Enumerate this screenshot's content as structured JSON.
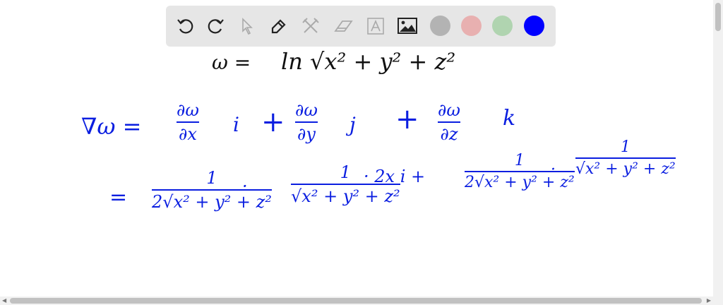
{
  "toolbar": {
    "tools": [
      "undo-icon",
      "redo-icon",
      "select-icon",
      "pen-icon",
      "tools-icon",
      "eraser-icon",
      "text-icon",
      "image-icon"
    ],
    "colors": [
      "#b3b3b3",
      "#e8b0b0",
      "#b0d4b0",
      "#0000ff"
    ]
  },
  "board": {
    "line1": {
      "lhs": "ω =",
      "rhs": "ln √x² + y² + z²"
    },
    "line2": {
      "lhs": "∇ω =",
      "t1_num": "∂ω",
      "t1_den": "∂x",
      "t1_unit": "i",
      "plus1": "+",
      "t2_num": "∂ω",
      "t2_den": "∂y",
      "t2_unit": "j",
      "plus2": "+",
      "t3_num": "∂ω",
      "t3_den": "∂z",
      "t3_unit": "k"
    },
    "line3": {
      "eq": "=",
      "f1_num": "1",
      "f1_den": "2√x² + y² + z²",
      "dot1": "·",
      "f2_num": "1",
      "f2_den": "√x² + y² + z²",
      "dot2": "· 2x  i  +",
      "f3_num": "1",
      "f3_den": "2√x² + y² + z²",
      "dot3": "·",
      "f4_num": "1",
      "f4_den": "√x² + y² + z²"
    }
  }
}
